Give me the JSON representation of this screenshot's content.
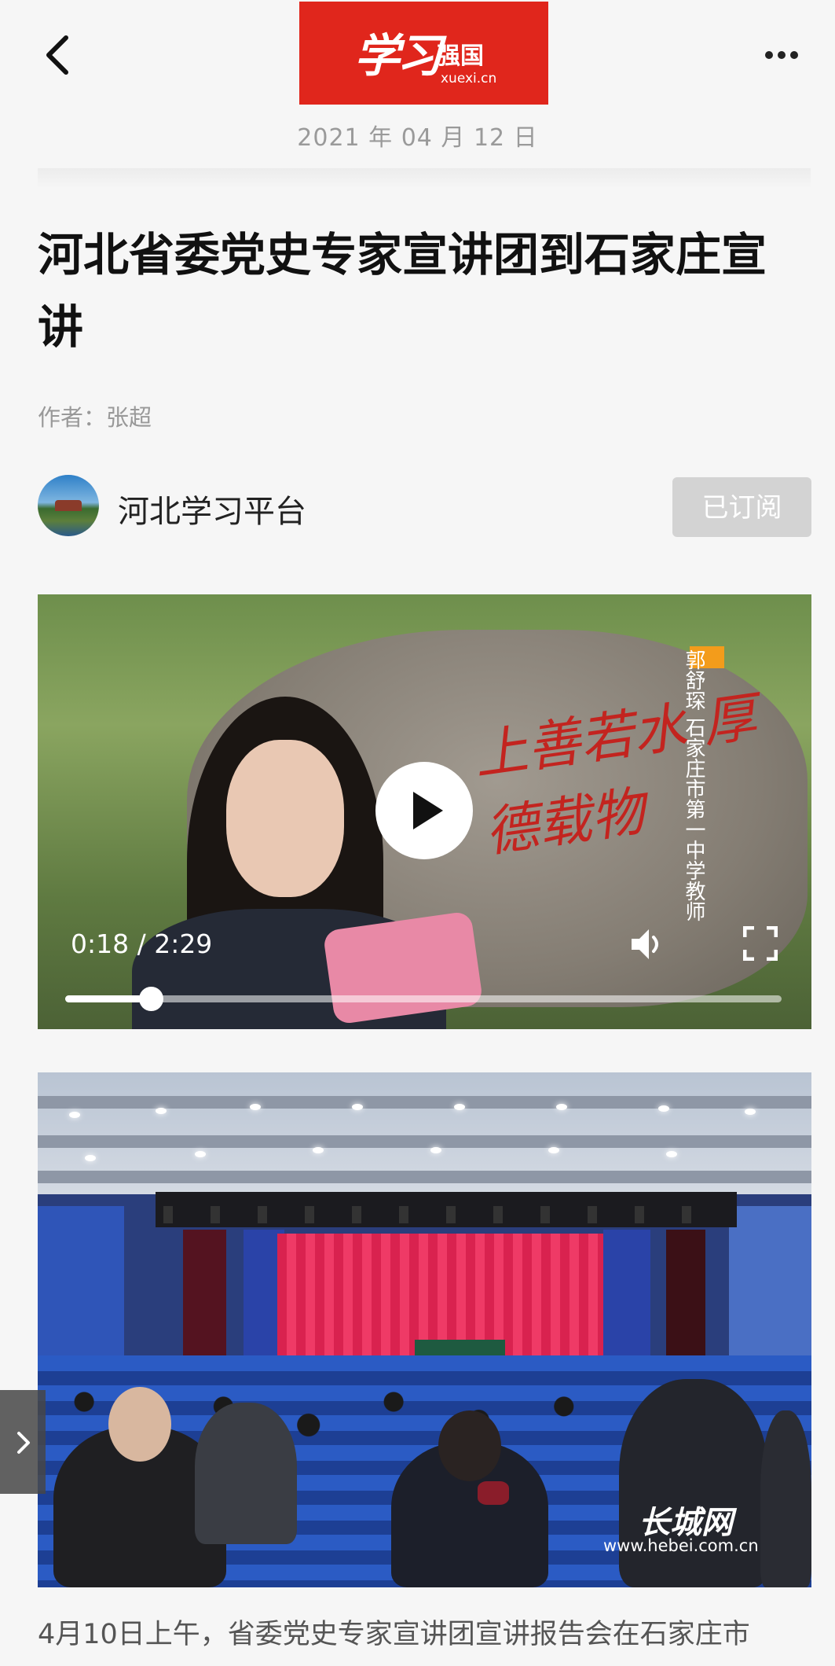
{
  "header": {
    "logo_main": "学习",
    "logo_sub": "强国",
    "logo_url": "xuexi.cn",
    "date": "2021 年 04 月 12 日"
  },
  "article": {
    "title": "河北省委党史专家宣讲团到石家庄宣讲",
    "author": "作者：张超",
    "body_first_line": "4月10日上午，省委党史专家宣讲团宣讲报告会在石家庄市"
  },
  "channel": {
    "name": "河北学习平台",
    "subscribe_label": "已订阅"
  },
  "video": {
    "current_time": "0:18",
    "duration": "2:29",
    "time_display": "0:18 / 2:29",
    "progress_fraction": 0.12,
    "caption_name": "郭舒琛",
    "caption_title": "石家庄市第一中学教师",
    "rock_inscription": "上善若水 厚德载物"
  },
  "photo": {
    "watermark_logo": "长城网",
    "watermark_url": "www.hebei.com.cn"
  },
  "colors": {
    "brand_red": "#e0261c",
    "subscribed_bg": "#d3d3d3",
    "date_gray": "#9a9a9a"
  }
}
